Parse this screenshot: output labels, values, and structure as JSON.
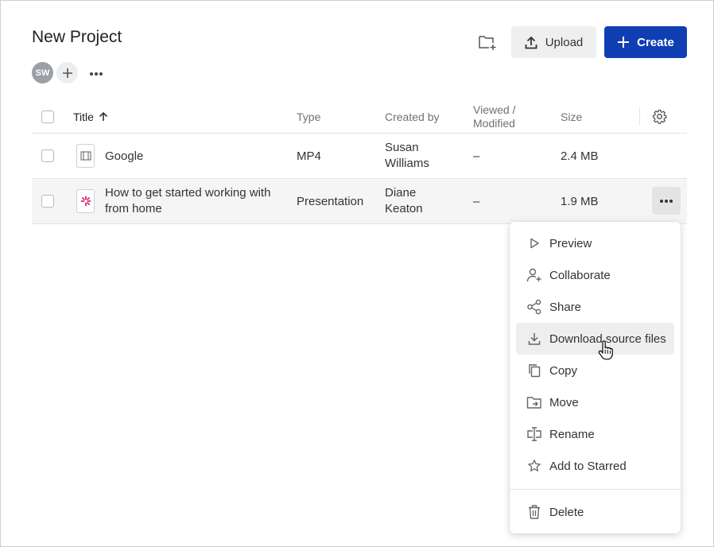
{
  "header": {
    "title": "New Project",
    "avatar_initials": "SW",
    "upload_label": "Upload",
    "create_label": "Create"
  },
  "table": {
    "columns": {
      "title": "Title",
      "type": "Type",
      "created_by": "Created by",
      "viewed_line1": "Viewed /",
      "viewed_line2": "Modified",
      "size": "Size"
    },
    "sort_indicator": "arrow-up-icon",
    "rows": [
      {
        "title": "Google",
        "type": "MP4",
        "created_line1": "Susan",
        "created_line2": "Williams",
        "viewed": "–",
        "size": "2.4 MB",
        "icon": "video-file-icon"
      },
      {
        "title_line1": "How to get started working with",
        "title_line2": "from home",
        "type": "Presentation",
        "created_line1": "Diane",
        "created_line2": "Keaton",
        "viewed": "–",
        "size": "1.9 MB",
        "icon": "presentation-file-icon"
      }
    ]
  },
  "context_menu": {
    "items": [
      {
        "label": "Preview",
        "icon": "play-icon"
      },
      {
        "label": "Collaborate",
        "icon": "add-person-icon"
      },
      {
        "label": "Share",
        "icon": "share-icon"
      },
      {
        "label": "Download source files",
        "icon": "download-icon",
        "active": true
      },
      {
        "label": "Copy",
        "icon": "copy-icon"
      },
      {
        "label": "Move",
        "icon": "move-folder-icon"
      },
      {
        "label": "Rename",
        "icon": "rename-icon"
      },
      {
        "label": "Add to Starred",
        "icon": "star-icon"
      }
    ],
    "delete": {
      "label": "Delete",
      "icon": "trash-icon"
    }
  },
  "colors": {
    "accent": "#0f3fb3",
    "presentation_icon": "#d6246e"
  }
}
